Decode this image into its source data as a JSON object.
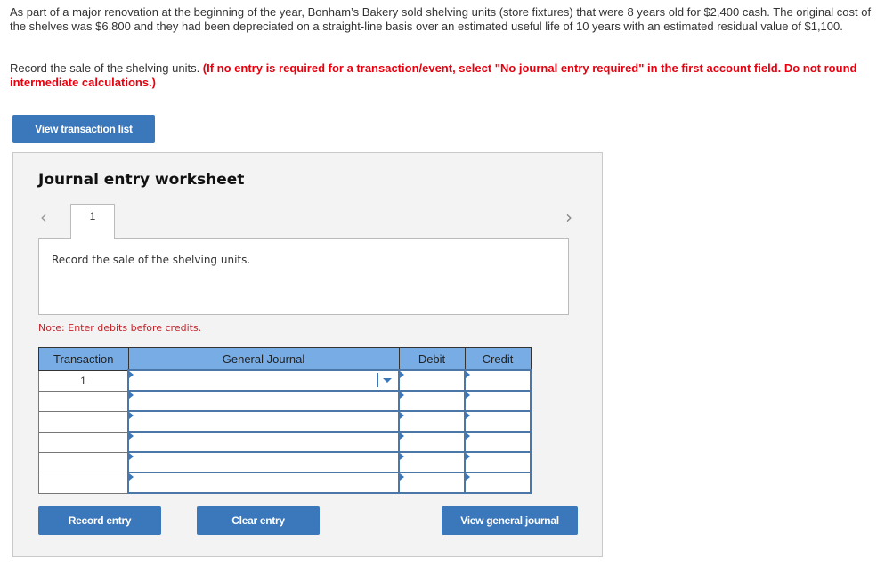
{
  "problem": {
    "text": "As part of a major renovation at the beginning of the year, Bonham’s Bakery sold shelving units (store fixtures) that were 8 years old for $2,400 cash. The original cost of the shelves was $6,800 and they had been depreciated on a straight-line basis over an estimated useful life of 10 years with an estimated residual value of $1,100."
  },
  "instruction": {
    "text": "Record the sale of the shelving units. ",
    "emphasis": "(If no entry is required for a transaction/event, select \"No journal entry required\" in the first account field. Do not round intermediate calculations.)"
  },
  "buttons": {
    "view_transaction_list": "View transaction list",
    "record_entry": "Record entry",
    "clear_entry": "Clear entry",
    "view_general_journal": "View general journal"
  },
  "worksheet": {
    "title": "Journal entry worksheet",
    "prev_icon": "‹",
    "next_icon": "›",
    "tab_label": "1",
    "description": "Record the sale of the shelving units.",
    "note": "Note: Enter debits before credits."
  },
  "table": {
    "headers": [
      "Transaction",
      "General Journal",
      "Debit",
      "Credit"
    ],
    "rows": [
      {
        "transaction": "1",
        "account": "",
        "debit": "",
        "credit": ""
      },
      {
        "transaction": "",
        "account": "",
        "debit": "",
        "credit": ""
      },
      {
        "transaction": "",
        "account": "",
        "debit": "",
        "credit": ""
      },
      {
        "transaction": "",
        "account": "",
        "debit": "",
        "credit": ""
      },
      {
        "transaction": "",
        "account": "",
        "debit": "",
        "credit": ""
      },
      {
        "transaction": "",
        "account": "",
        "debit": "",
        "credit": ""
      }
    ]
  },
  "colors": {
    "button": "#3a77bb",
    "header": "#78ace4",
    "emphasis": "#e8000e",
    "note": "#c0252b"
  }
}
